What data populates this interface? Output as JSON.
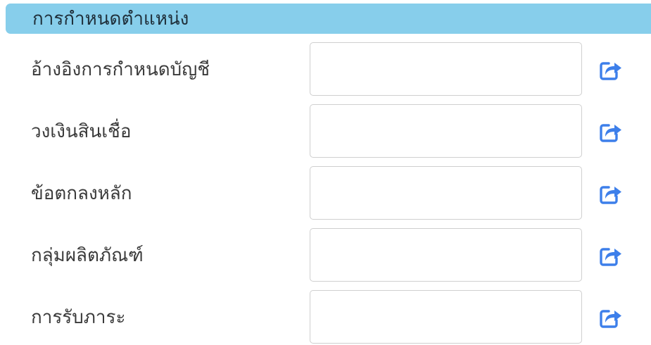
{
  "section": {
    "title": "การกำหนดตำแหน่ง"
  },
  "colors": {
    "header_bg": "#87CEEB",
    "icon": "#3D7FEA",
    "input_border": "#cfcfcf"
  },
  "rows": [
    {
      "label": "อ้างอิงการกำหนดบัญชี",
      "value": "",
      "icon": "share-external-icon"
    },
    {
      "label": "วงเงินสินเชื่อ",
      "value": "",
      "icon": "share-external-icon"
    },
    {
      "label": "ข้อตกลงหลัก",
      "value": "",
      "icon": "share-external-icon"
    },
    {
      "label": "กลุ่มผลิตภัณฑ์",
      "value": "",
      "icon": "share-external-icon"
    },
    {
      "label": "การรับภาระ",
      "value": "",
      "icon": "share-external-icon"
    }
  ]
}
